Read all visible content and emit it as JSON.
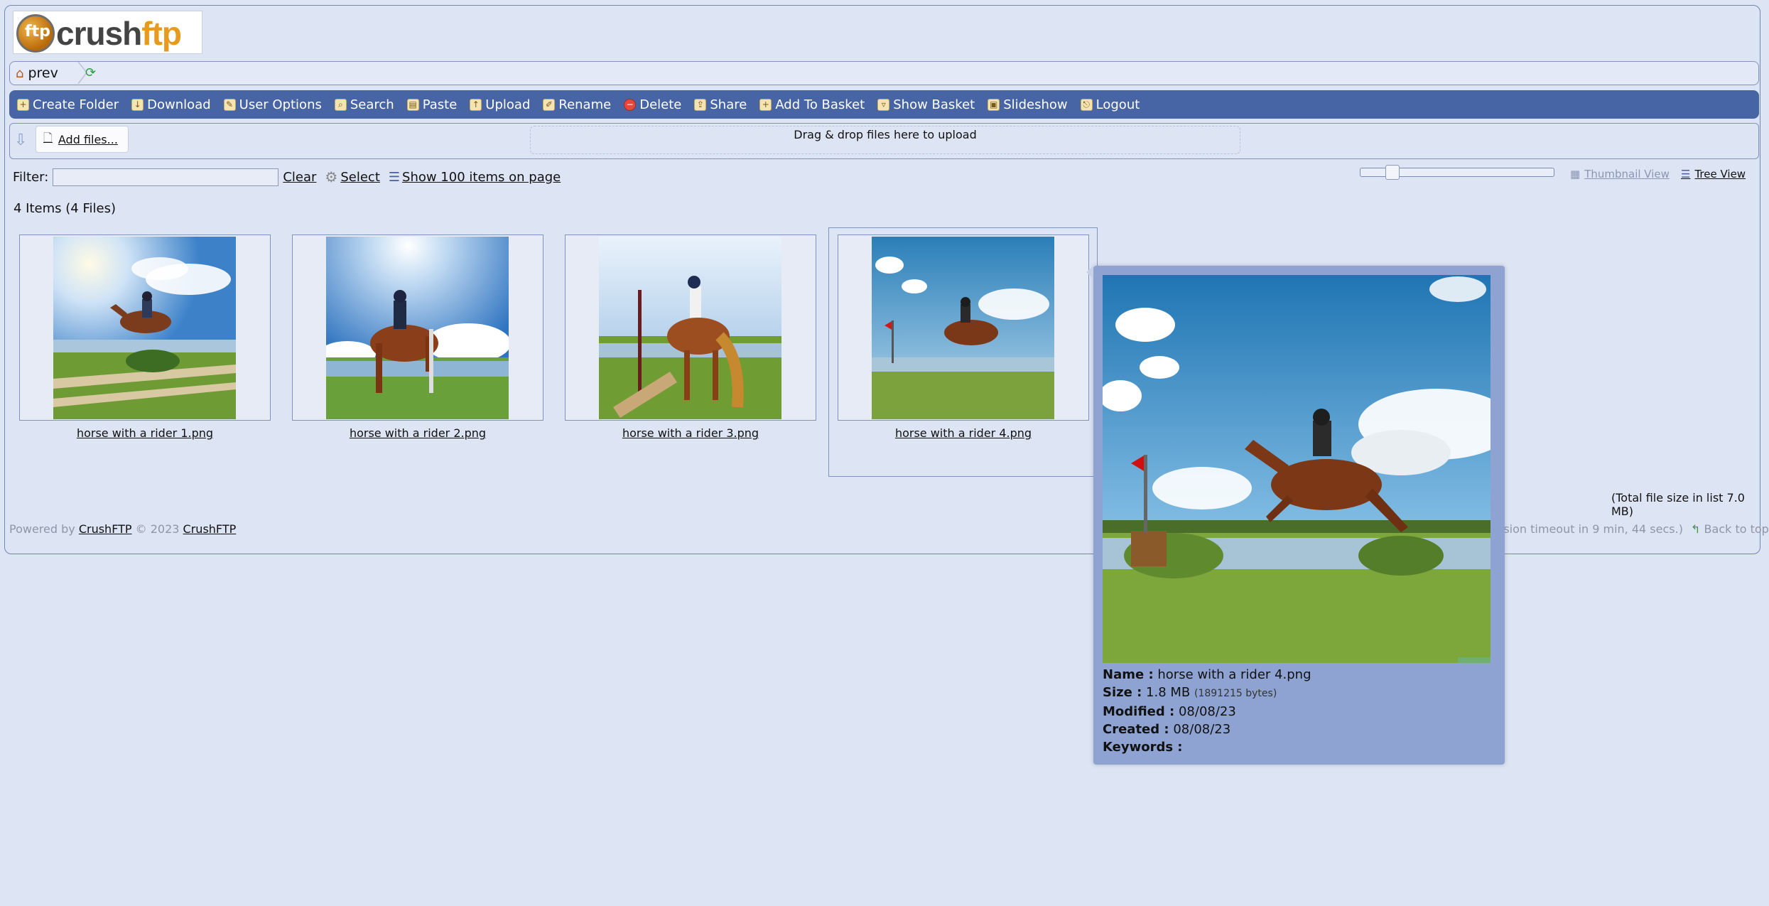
{
  "logo": {
    "text_a": "crush",
    "text_b": "ftp",
    "badge": "ftp"
  },
  "breadcrumb": {
    "label": "prev"
  },
  "toolbar": [
    {
      "label": "Create Folder",
      "icon": "folder-add-icon"
    },
    {
      "label": "Download",
      "icon": "download-icon"
    },
    {
      "label": "User Options",
      "icon": "user-options-icon"
    },
    {
      "label": "Search",
      "icon": "search-icon"
    },
    {
      "label": "Paste",
      "icon": "paste-icon"
    },
    {
      "label": "Upload",
      "icon": "upload-icon"
    },
    {
      "label": "Rename",
      "icon": "rename-icon"
    },
    {
      "label": "Delete",
      "icon": "delete-icon"
    },
    {
      "label": "Share",
      "icon": "share-icon"
    },
    {
      "label": "Add To Basket",
      "icon": "basket-add-icon"
    },
    {
      "label": "Show Basket",
      "icon": "basket-icon"
    },
    {
      "label": "Slideshow",
      "icon": "slideshow-icon"
    },
    {
      "label": "Logout",
      "icon": "logout-icon"
    }
  ],
  "upload": {
    "add_files": "Add files...",
    "dropzone": "Drag & drop files here to upload"
  },
  "filter": {
    "label": "Filter:",
    "value": "",
    "clear": "Clear",
    "select": "Select",
    "show_items": "Show 100 items on page"
  },
  "views": {
    "thumbnail": "Thumbnail View",
    "tree": "Tree View"
  },
  "count": "4 Items (4 Files)",
  "files": [
    {
      "name": "horse with a rider 1.png"
    },
    {
      "name": "horse with a rider 2.png"
    },
    {
      "name": "horse with a rider 3.png"
    },
    {
      "name": "horse with a rider 4.png"
    }
  ],
  "total_size": "(Total file size in list 7.0 MB)",
  "footer": {
    "powered": "Powered by",
    "link1": "CrushFTP",
    "copyright": "© 2023",
    "link2": "CrushFTP",
    "session": "ssion timeout in 9 min, 44 secs.)",
    "back_top": "Back to top"
  },
  "popup": {
    "name_label": "Name :",
    "name_value": "horse with a rider 4.png",
    "size_label": "Size :",
    "size_value": "1.8 MB",
    "size_bytes": "(1891215 bytes)",
    "modified_label": "Modified :",
    "modified_value": "08/08/23",
    "created_label": "Created :",
    "created_value": "08/08/23",
    "keywords_label": "Keywords :",
    "keywords_value": ""
  },
  "colors": {
    "toolbar": "#4764a5",
    "page_bg": "#dde4f3",
    "popup_bg": "#8ea3d1",
    "border": "#7f93c1"
  }
}
